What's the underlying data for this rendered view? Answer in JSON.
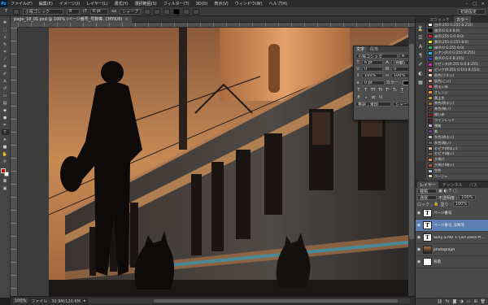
{
  "menubar": {
    "logo": "Ps",
    "items": [
      "ファイル(F)",
      "編集(E)",
      "イメージ(I)",
      "レイヤー(L)",
      "書式(Y)",
      "選択範囲(S)",
      "フィルター(T)",
      "3D(D)",
      "表示(V)",
      "ウィンドウ(W)",
      "ヘルプ(H)"
    ]
  },
  "options": {
    "font": "小塚ゴシック",
    "style": "R",
    "size": "6 pt",
    "antialias": "シャープ",
    "workspace": "初期設定"
  },
  "document": {
    "tab_title": "page_18_01.psd @ 100% (ページ番号_号数等, CMYK/8)",
    "zoom": "100%",
    "doc_info": "ファイル : 30.9M/120.6M"
  },
  "character_panel": {
    "tabs": [
      "文字",
      "段落"
    ],
    "font": "小塚ゴシック",
    "style": "R",
    "size": "6 pt",
    "leading": "(自動)",
    "tracking": "0",
    "kerning": "0",
    "scale_v": "100%",
    "scale_h": "100%",
    "baseline": "0 pt",
    "color_label": "カラー :",
    "language": "英語 : 米国",
    "aa": "シャープ"
  },
  "right_panels": {
    "top_tabs": [
      "スウォッチ",
      "カラー"
    ],
    "swatches": [
      {
        "name": "白(R:255 G:255 B:255)",
        "color": "#ffffff"
      },
      {
        "name": "黒(R:0 G:0 B:0)",
        "color": "#000000"
      },
      {
        "name": "赤(R:255 G:0 B:0)",
        "color": "#e11b1b"
      },
      {
        "name": "黄(R:255 G:255 B:0)",
        "color": "#f5e21c"
      },
      {
        "name": "緑(R:0 G:255 B:0)",
        "color": "#2eb84a"
      },
      {
        "name": "シアン(R:0 G:255 B:255)",
        "color": "#27b6e8"
      },
      {
        "name": "青(R:0 G:0 B:255)",
        "color": "#2b44c4"
      },
      {
        "name": "マゼンタ(R:255 G:0 B:255)",
        "color": "#d82aa0"
      },
      {
        "name": "ピンク(R:255 G:153 B:153)",
        "color": "#f4a3a3"
      },
      {
        "name": "肌色(うすい)",
        "color": "#f3d2b4"
      },
      {
        "name": "肌色(こい)",
        "color": "#e2a67a"
      },
      {
        "name": "明るい赤",
        "color": "#f05a50"
      },
      {
        "name": "オレンジ",
        "color": "#f39a2e"
      },
      {
        "name": "黄土色",
        "color": "#c89a3a"
      },
      {
        "name": "茶色(明るい)",
        "color": "#a8703c"
      },
      {
        "name": "茶色(暗い)",
        "color": "#6b4226"
      },
      {
        "name": "暗い赤",
        "color": "#8e1f1f"
      },
      {
        "name": "ワインレッド",
        "color": "#6d1730"
      },
      {
        "name": "薄紫",
        "color": "#c8a6d8"
      },
      {
        "name": "紫",
        "color": "#7a3f98"
      },
      {
        "name": "灰色(明るい)",
        "color": "#bdbdbd"
      },
      {
        "name": "灰色(暗い)",
        "color": "#6a6a6a"
      },
      {
        "name": "セピア(明るい)",
        "color": "#d9b48a"
      },
      {
        "name": "セピア(暗い)",
        "color": "#8a6040"
      },
      {
        "name": "夕焼け",
        "color": "#e48a4c"
      },
      {
        "name": "夕焼け(暗い)",
        "color": "#b35a2c"
      },
      {
        "name": "空色",
        "color": "#9fc7e8"
      },
      {
        "name": "ベージュ",
        "color": "#e6cfae"
      }
    ],
    "layers": {
      "tabs": [
        "レイヤー",
        "チャンネル",
        "パス"
      ],
      "kind": "種類",
      "blend": "通常",
      "opacity_label": "不透明度 :",
      "opacity": "100%",
      "lock_label": "ロック :",
      "fill_label": "塗り :",
      "fill": "100%",
      "items": [
        {
          "name": "ページ番号",
          "kind": "text",
          "selected": false
        },
        {
          "name": "ページ番号_号数等",
          "kind": "text",
          "selected": true
        },
        {
          "name": "Sony α700 + Carl Zeiss Pl...",
          "kind": "text",
          "selected": false
        },
        {
          "name": "photograph",
          "kind": "photo",
          "selected": false
        },
        {
          "name": "背景",
          "kind": "white",
          "selected": false
        }
      ]
    }
  },
  "colors": {
    "foreground": "#b80000",
    "background": "#ffffff",
    "selection": "#5a7fb0"
  }
}
